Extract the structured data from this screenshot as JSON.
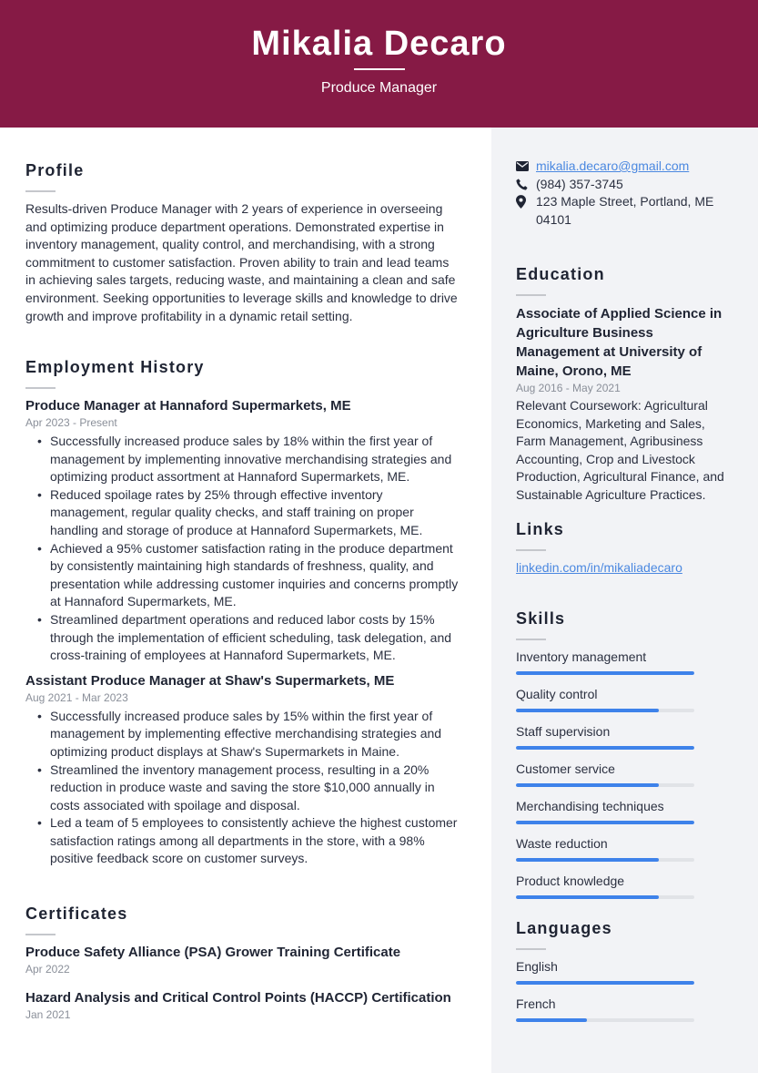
{
  "header": {
    "name": "Mikalia Decaro",
    "title": "Produce Manager",
    "background_color": "#861a45"
  },
  "profile": {
    "heading": "Profile",
    "text": "Results-driven Produce Manager with 2 years of experience in overseeing and optimizing produce department operations. Demonstrated expertise in inventory management, quality control, and merchandising, with a strong commitment to customer satisfaction. Proven ability to train and lead teams in achieving sales targets, reducing waste, and maintaining a clean and safe environment. Seeking opportunities to leverage skills and knowledge to drive growth and improve profitability in a dynamic retail setting."
  },
  "employment": {
    "heading": "Employment History",
    "jobs": [
      {
        "title": "Produce Manager at Hannaford Supermarkets, ME",
        "dates": "Apr 2023 - Present",
        "bullets": [
          "Successfully increased produce sales by 18% within the first year of management by implementing innovative merchandising strategies and optimizing product assortment at Hannaford Supermarkets, ME.",
          "Reduced spoilage rates by 25% through effective inventory management, regular quality checks, and staff training on proper handling and storage of produce at Hannaford Supermarkets, ME.",
          "Achieved a 95% customer satisfaction rating in the produce department by consistently maintaining high standards of freshness, quality, and presentation while addressing customer inquiries and concerns promptly at Hannaford Supermarkets, ME.",
          "Streamlined department operations and reduced labor costs by 15% through the implementation of efficient scheduling, task delegation, and cross-training of employees at Hannaford Supermarkets, ME."
        ]
      },
      {
        "title": "Assistant Produce Manager at Shaw's Supermarkets, ME",
        "dates": "Aug 2021 - Mar 2023",
        "bullets": [
          "Successfully increased produce sales by 15% within the first year of management by implementing effective merchandising strategies and optimizing product displays at Shaw's Supermarkets in Maine.",
          "Streamlined the inventory management process, resulting in a 20% reduction in produce waste and saving the store $10,000 annually in costs associated with spoilage and disposal.",
          "Led a team of 5 employees to consistently achieve the highest customer satisfaction ratings among all departments in the store, with a 98% positive feedback score on customer surveys."
        ]
      }
    ]
  },
  "certificates": {
    "heading": "Certificates",
    "items": [
      {
        "title": "Produce Safety Alliance (PSA) Grower Training Certificate",
        "date": "Apr 2022"
      },
      {
        "title": "Hazard Analysis and Critical Control Points (HACCP) Certification",
        "date": "Jan 2021"
      }
    ]
  },
  "contact": {
    "email": "mikalia.decaro@gmail.com",
    "phone": "(984) 357-3745",
    "address": "123 Maple Street, Portland, ME 04101",
    "icons": [
      "envelope-icon",
      "phone-icon",
      "map-pin-icon"
    ]
  },
  "education": {
    "heading": "Education",
    "degree": "Associate of Applied Science in Agriculture Business Management at University of Maine, Orono, ME",
    "dates": "Aug 2016 - May 2021",
    "description": "Relevant Coursework: Agricultural Economics, Marketing and Sales, Farm Management, Agribusiness Accounting, Crop and Livestock Production, Agricultural Finance, and Sustainable Agriculture Practices."
  },
  "links": {
    "heading": "Links",
    "items": [
      "linkedin.com/in/mikaliadecaro"
    ]
  },
  "skills": {
    "heading": "Skills",
    "bar_color": "#3e82ea",
    "items": [
      {
        "name": "Inventory management",
        "level": 1.0
      },
      {
        "name": "Quality control",
        "level": 0.8
      },
      {
        "name": "Staff supervision",
        "level": 1.0
      },
      {
        "name": "Customer service",
        "level": 0.8
      },
      {
        "name": "Merchandising techniques",
        "level": 1.0
      },
      {
        "name": "Waste reduction",
        "level": 0.8
      },
      {
        "name": "Product knowledge",
        "level": 0.8
      }
    ]
  },
  "languages": {
    "heading": "Languages",
    "items": [
      {
        "name": "English",
        "level": 1.0
      },
      {
        "name": "French",
        "level": 0.4
      }
    ]
  }
}
